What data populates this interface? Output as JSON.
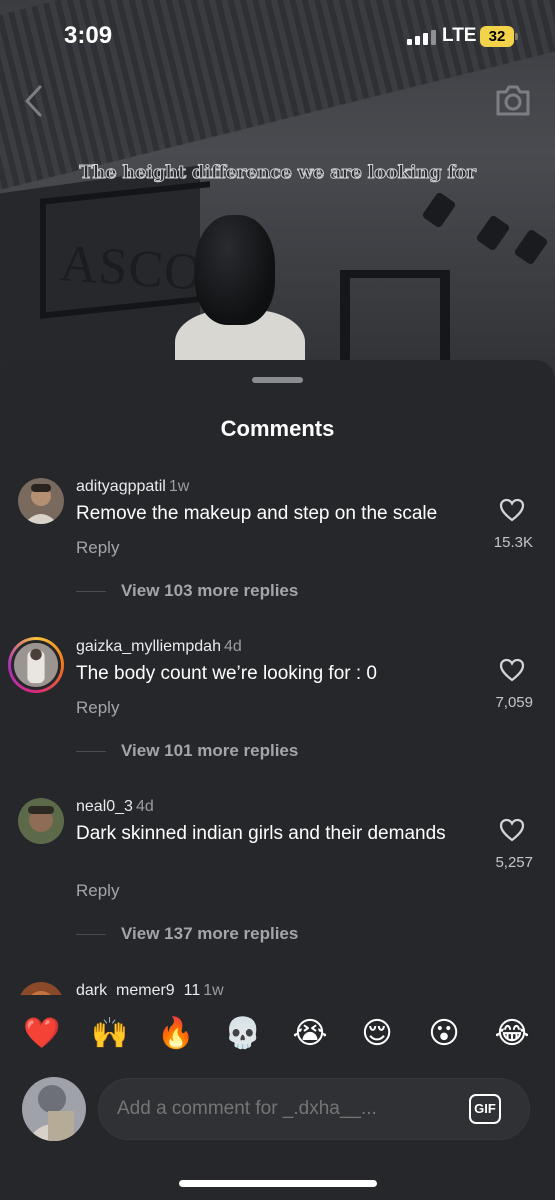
{
  "status_bar": {
    "time": "3:09",
    "network": "LTE",
    "battery": "32"
  },
  "video": {
    "caption": "The height difference we are looking for",
    "sign_text": "ASCOT"
  },
  "sheet": {
    "title": "Comments"
  },
  "comments": [
    {
      "username": "adityagppatil",
      "age": "1w",
      "text": "Remove the makeup and step on the scale",
      "reply_label": "Reply",
      "likes": "15.3K",
      "view_replies": "View 103 more replies"
    },
    {
      "username": "gaizka_mylliempdah",
      "age": "4d",
      "text": "The body count we’re looking for : 0",
      "reply_label": "Reply",
      "likes": "7,059",
      "view_replies": "View 101 more replies"
    },
    {
      "username": "neal0_3",
      "age": "4d",
      "text": "Dark skinned indian girls and their demands",
      "reply_label": "Reply",
      "likes": "5,257",
      "view_replies": "View 137 more replies"
    },
    {
      "username": "dark_memer9_11",
      "age": "1w"
    }
  ],
  "emoji_bar": [
    "❤️",
    "🙌",
    "🔥",
    "💀",
    "😭",
    "😌",
    "😮",
    "😂"
  ],
  "composer": {
    "placeholder": "Add a comment for _.dxha__...",
    "gif_label": "GIF"
  },
  "colors": {
    "sheet_bg": "#25272b",
    "accent_battery": "#f2d34a",
    "muted_text": "#a3a5a9"
  }
}
